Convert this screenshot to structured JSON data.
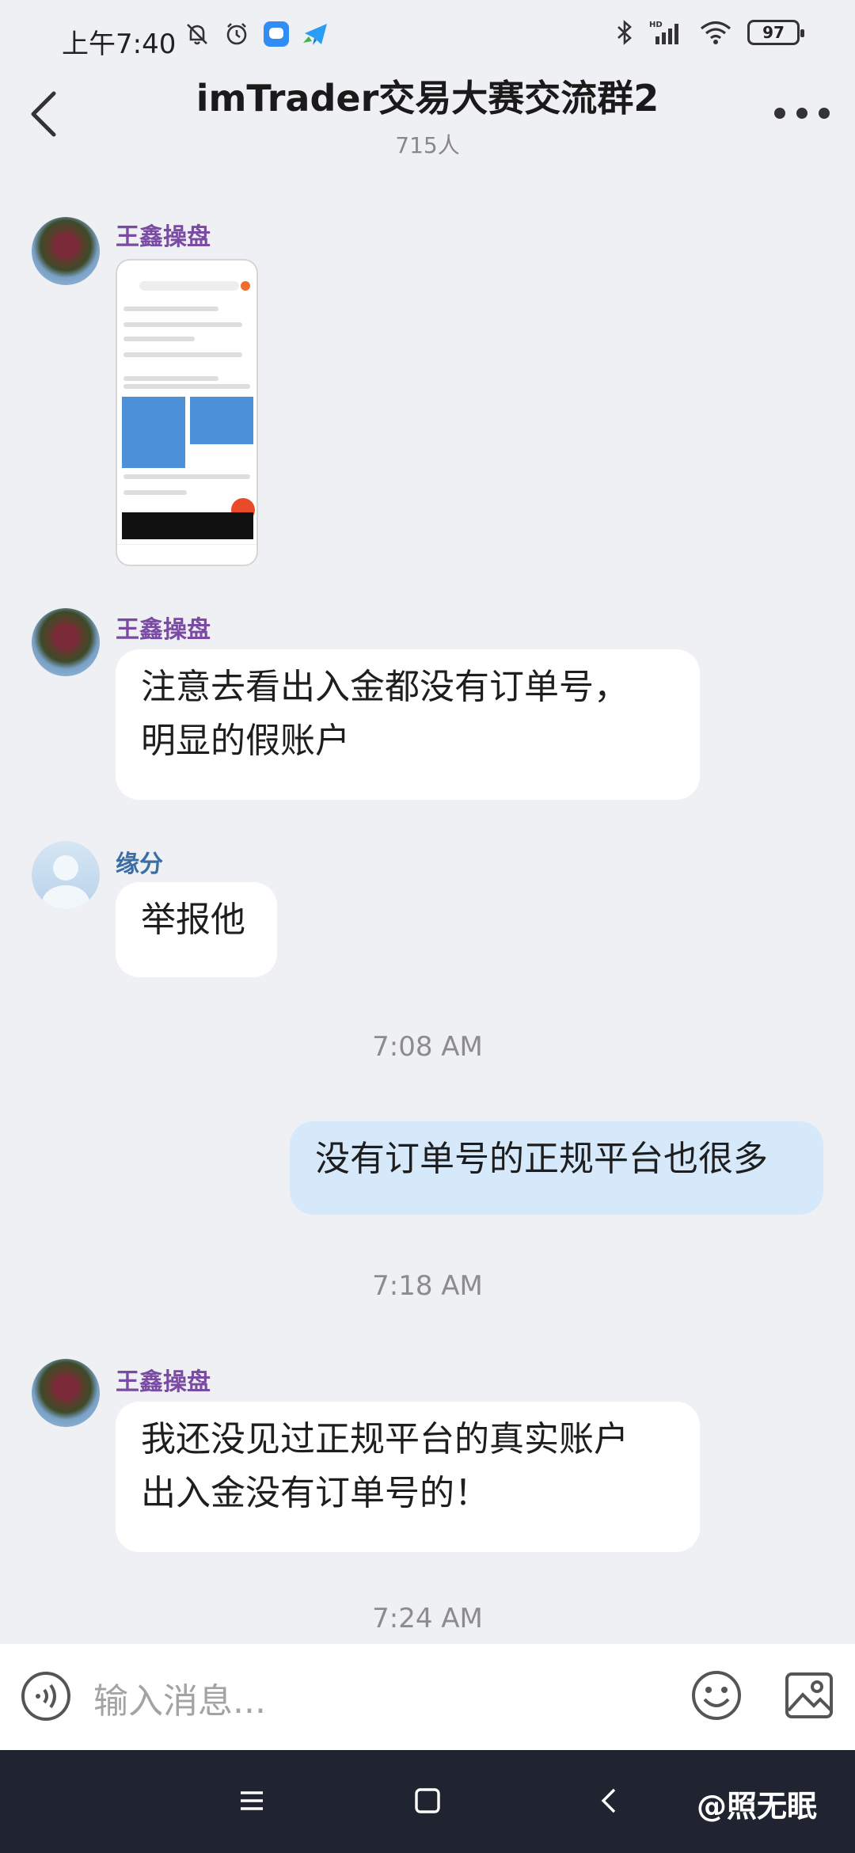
{
  "status_bar": {
    "time": "上午7:40",
    "battery": "97",
    "icons": [
      "mute-bell-icon",
      "alarm-icon",
      "app-icon-blue",
      "telegram-icon",
      "bluetooth-icon",
      "hd-signal-icon",
      "wifi-icon",
      "battery-icon"
    ]
  },
  "header": {
    "title": "imTrader交易大赛交流群2",
    "members": "715人"
  },
  "messages": [
    {
      "sender": "王鑫操盘",
      "type": "image"
    },
    {
      "sender": "王鑫操盘",
      "text": "注意去看出入金都没有订单号，\n明显的假账户"
    },
    {
      "sender": "缘分",
      "text": "举报他"
    },
    {
      "timestamp": "7:08 AM"
    },
    {
      "sender": "me",
      "text": "没有订单号的正规平台也很多"
    },
    {
      "timestamp": "7:18 AM"
    },
    {
      "sender": "王鑫操盘",
      "text": "我还没见过正规平台的真实账户\n出入金没有订单号的！"
    },
    {
      "timestamp": "7:24 AM"
    }
  ],
  "input": {
    "placeholder": "输入消息..."
  },
  "nav": {
    "watermark": "@照无眠"
  }
}
